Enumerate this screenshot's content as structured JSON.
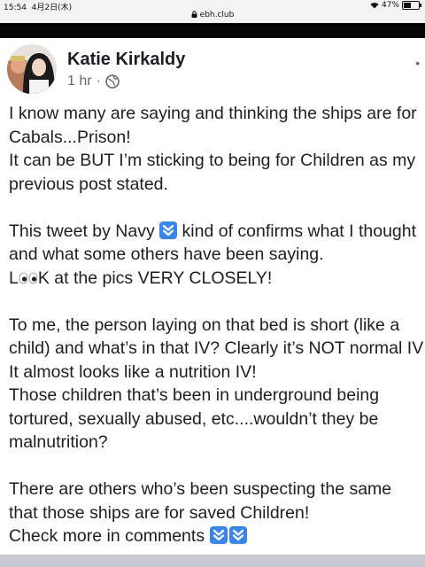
{
  "status_bar": {
    "time": "15:54",
    "date": "4月2日(木)",
    "battery": "47%",
    "battery_level": 0.47
  },
  "browser": {
    "url": "ebh.club"
  },
  "post": {
    "author": "Katie Kirkaldy",
    "time": "1 hr",
    "separator": "·",
    "more": "•",
    "lines": {
      "l1": "I know many are saying and thinking the ships are for",
      "l2": "Cabals...Prison!",
      "l3": "It can be BUT I’m sticking to being for Children as my",
      "l4": "previous post stated.",
      "l5a": "This tweet by Navy ",
      "l5b": " kind of confirms what I thought",
      "l6": "and what some others have been saying.",
      "l7a": "L",
      "l7b": "K at the pics VERY CLOSELY!",
      "l8": "To me, the person laying on that bed is short (like a",
      "l9": "child) and what’s in that IV? Clearly it’s NOT normal IV",
      "l10": "It almost looks like a nutrition IV!",
      "l11": "Those children that’s been in underground being",
      "l12": "tortured, sexually abused, etc....wouldn’t they be",
      "l13": "malnutrition?",
      "l14": "There are others who’s been suspecting the same",
      "l15": "that those ships are for saved Children!",
      "l16": "Check more in comments "
    }
  },
  "icons": {
    "down_arrow_emoji": "double-down-arrow-icon",
    "eyes_emoji": "eyes-icon",
    "audience": "globe-icon",
    "lock": "lock-icon"
  },
  "colors": {
    "emoji_blue": "#3a86e8",
    "text": "#1c1e21",
    "meta": "#65676b",
    "bar": "#050505"
  }
}
